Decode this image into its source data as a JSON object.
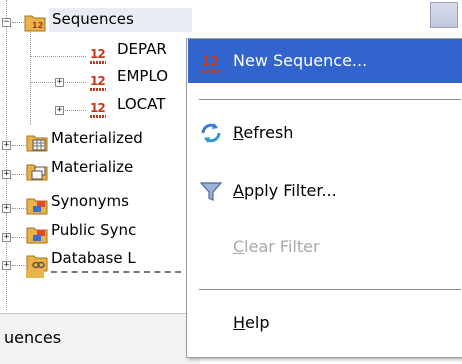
{
  "tree": {
    "items": [
      {
        "label": "Sequences",
        "icon": "sequences-folder-icon"
      },
      {
        "label": "DEPAR",
        "icon": "sequence-icon",
        "icon_text": "12"
      },
      {
        "label": "EMPLO",
        "icon": "sequence-icon",
        "icon_text": "12"
      },
      {
        "label": "LOCAT",
        "icon": "sequence-icon",
        "icon_text": "12"
      },
      {
        "label": "Materialized",
        "icon": "materialized-view-folder-icon"
      },
      {
        "label": "Materialize",
        "icon": "materialized-view-log-folder-icon"
      },
      {
        "label": "Synonyms",
        "icon": "synonyms-folder-icon"
      },
      {
        "label": "Public Sync",
        "icon": "public-synonyms-folder-icon"
      },
      {
        "label": "Database L",
        "icon": "database-links-folder-icon"
      }
    ],
    "expand_symbol": "+",
    "collapse_symbol": "−"
  },
  "bottom_tab": {
    "label": "uences"
  },
  "context_menu": {
    "items": [
      {
        "label": "New Sequence...",
        "icon": "new-sequence-icon",
        "icon_text": "12",
        "state": "highlighted"
      },
      {
        "label_mnemonic": "R",
        "label_rest": "efresh",
        "icon": "refresh-icon",
        "state": "enabled"
      },
      {
        "label_mnemonic": "A",
        "label_rest": "pply Filter...",
        "icon": "filter-icon",
        "state": "enabled"
      },
      {
        "label_mnemonic": "C",
        "label_rest": "lear Filter",
        "icon": "",
        "state": "disabled"
      },
      {
        "label_mnemonic": "H",
        "label_rest": "elp",
        "icon": "",
        "state": "enabled"
      }
    ]
  },
  "colors": {
    "highlight": "#3165cd",
    "disabled_text": "#a9a9a9",
    "sequence_icon": "#c23a1c"
  }
}
